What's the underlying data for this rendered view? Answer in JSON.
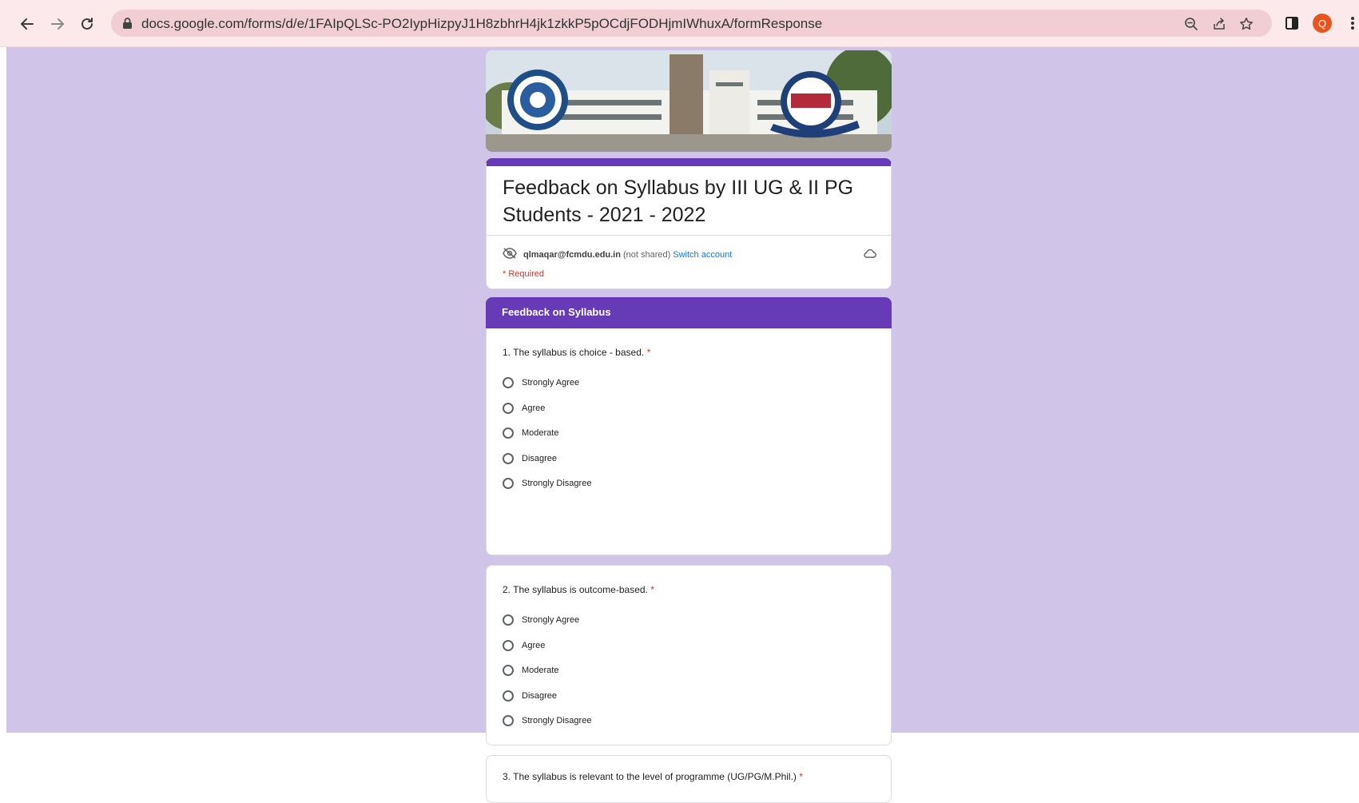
{
  "browser": {
    "url": "docs.google.com/forms/d/e/1FAIpQLSc-PO2IypHizpyJ1H8zbhrH4jk1zkkP5pOCdjFODHjmIWhuxA/formResponse",
    "profile_initial": "Q"
  },
  "form": {
    "title": "Feedback on Syllabus by III UG & II PG Students - 2021 - 2022",
    "account_email": "qlmaqar@fcmdu.edu.in",
    "not_shared": "(not shared)",
    "switch_account": "Switch account",
    "required_note": "* Required",
    "section_title": "Feedback on Syllabus",
    "required_mark": "*"
  },
  "questions": [
    {
      "text": "1. The syllabus is choice - based.",
      "options": [
        "Strongly Agree",
        "Agree",
        "Moderate",
        "Disagree",
        "Strongly Disagree"
      ]
    },
    {
      "text": "2. The syllabus is outcome-based.",
      "options": [
        "Strongly Agree",
        "Agree",
        "Moderate",
        "Disagree",
        "Strongly Disagree"
      ]
    },
    {
      "text": "3. The syllabus is relevant to the level of programme (UG/PG/M.Phil.)"
    }
  ],
  "colors": {
    "theme": "#673ab7",
    "background": "#d1c4e9",
    "required": "#d93025",
    "link": "#1a73e8"
  },
  "icons": [
    "back-arrow-icon",
    "forward-arrow-icon",
    "reload-icon",
    "lock-icon",
    "zoom-out-icon",
    "share-icon",
    "star-icon",
    "side-panel-icon",
    "more-vert-icon",
    "eye-off-icon",
    "cloud-icon"
  ]
}
